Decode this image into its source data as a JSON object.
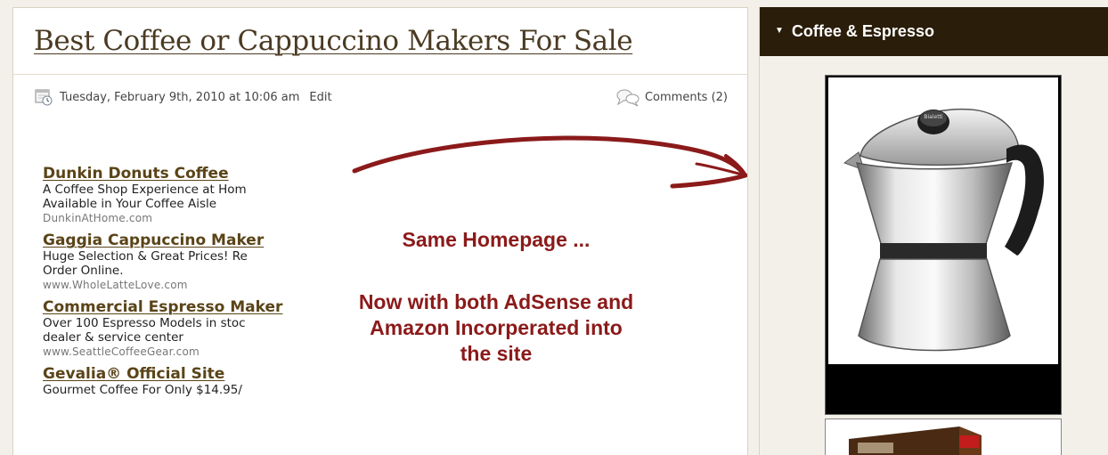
{
  "post": {
    "title": "Best Coffee or Cappuccino Makers For Sale",
    "date": "Tuesday, February 9th, 2010 at 10:06 am",
    "edit_label": "Edit",
    "comments_label": "Comments (2)"
  },
  "ads": [
    {
      "title": "Dunkin Donuts Coffee",
      "line1": "A Coffee Shop Experience at Hom",
      "line2": "Available in Your Coffee Aisle",
      "url": "DunkinAtHome.com"
    },
    {
      "title": "Gaggia Cappuccino Maker",
      "line1": "Huge Selection & Great Prices! Re",
      "line2": "Order Online.",
      "url": "www.WholeLatteLove.com"
    },
    {
      "title": "Commercial Espresso Maker",
      "line1": "Over 100 Espresso Models in stoc",
      "line2": "dealer & service center",
      "url": "www.SeattleCoffeeGear.com"
    },
    {
      "title": "Gevalia® Official Site",
      "line1": "Gourmet Coffee For Only $14.95/",
      "line2": "",
      "url": ""
    }
  ],
  "annotation": {
    "line1": "Same Homepage ...",
    "line2": "Now with both AdSense and",
    "line3": "Amazon Incorperated into",
    "line4": "the site"
  },
  "sidebar": {
    "heading": "Coffee & Espresso",
    "heading_icon": "triangle-down-icon",
    "product_text": "Bialetti"
  },
  "colors": {
    "annotation": "#8b1a1a",
    "sidebar_header": "#2a1d09",
    "link": "#5a4418"
  }
}
